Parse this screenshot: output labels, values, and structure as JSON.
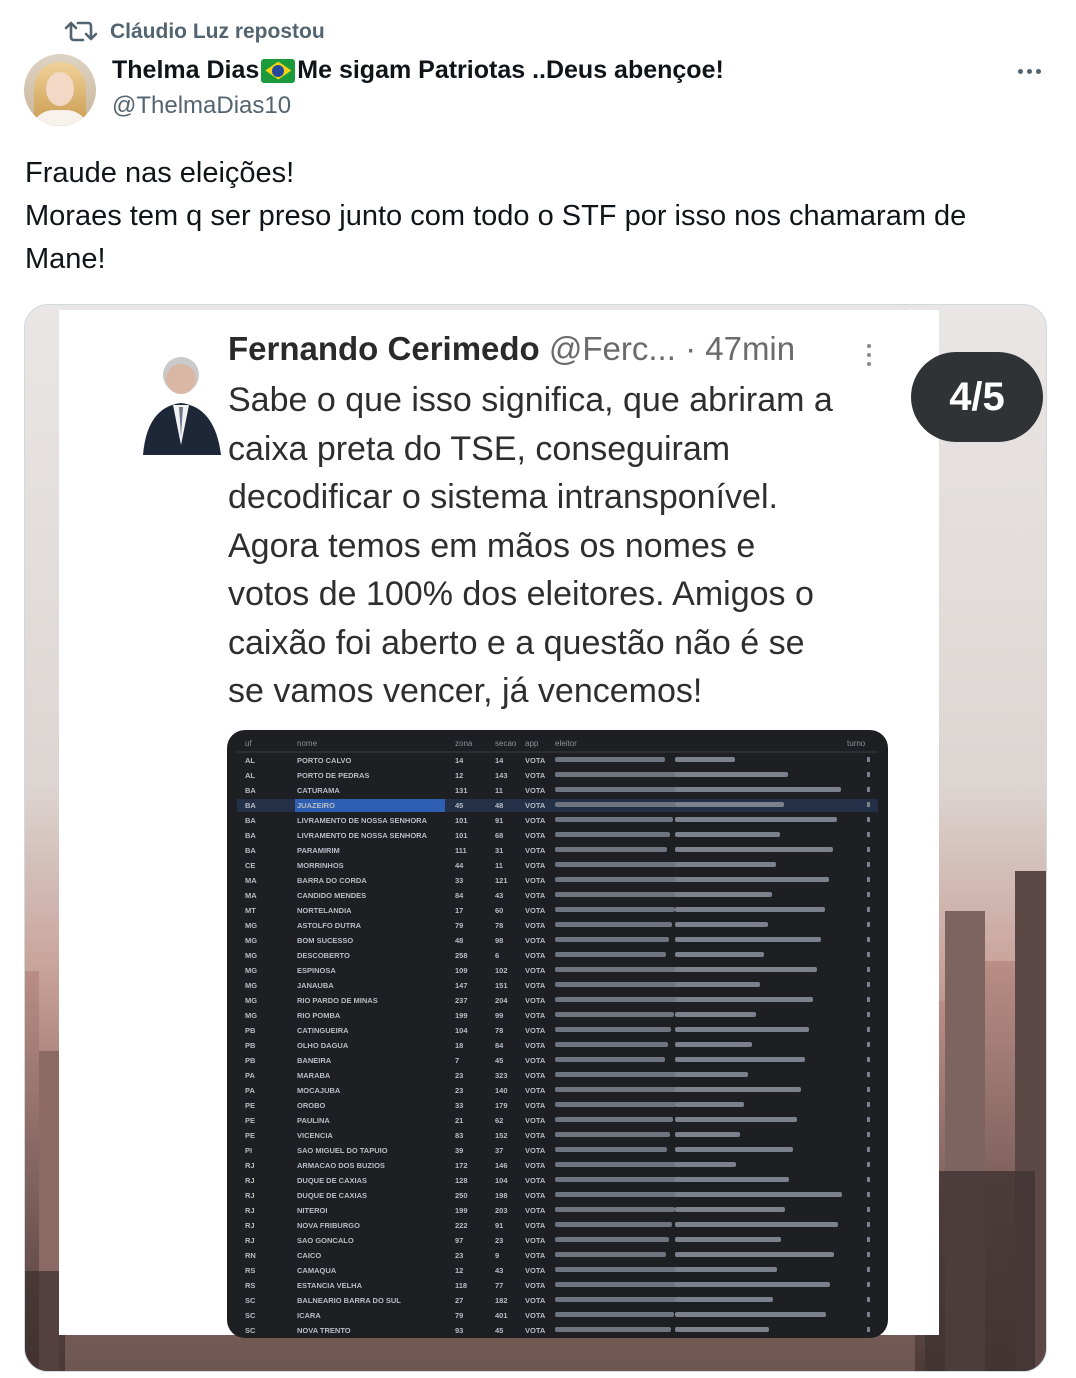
{
  "repost": {
    "icon": "repost-icon",
    "text": "Cláudio Luz repostou"
  },
  "author": {
    "name_part1": "Thelma Dias",
    "flag_icon": "brazil-flag-emoji",
    "name_part2": "Me sigam Patriotas ..Deus abençoe!",
    "handle": "@ThelmaDias10"
  },
  "post": {
    "lines": [
      "Fraude nas eleições!",
      "Moraes tem q ser preso junto com todo o STF por isso nos chamaram de",
      "Mane!"
    ]
  },
  "media": {
    "pager": "4/5",
    "ghost_pager": "4/5",
    "quoted": {
      "name": "Fernando Cerimedo",
      "handle": "@Ferc...",
      "time": "· 47min",
      "lines": [
        "Sabe o que isso significa, que abriram a",
        "caixa preta do TSE, conseguiram",
        "decodificar o sistema intransponível.",
        "Agora temos em mãos os nomes e",
        "votos de 100% dos eleitores. Amigos o",
        "caixão foi aberto e a questão não é se",
        "se vamos vencer, já vencemos!"
      ]
    },
    "table": {
      "headers": [
        "uf",
        "nome",
        "zona",
        "secao",
        "app",
        "eleitor",
        "turno"
      ],
      "rows": [
        [
          "AL",
          "PORTO CALVO",
          "14",
          "14",
          "VOTA"
        ],
        [
          "AL",
          "PORTO DE PEDRAS",
          "12",
          "143",
          "VOTA"
        ],
        [
          "BA",
          "CATURAMA",
          "131",
          "11",
          "VOTA"
        ],
        [
          "BA",
          "JUAZEIRO",
          "45",
          "48",
          "VOTA"
        ],
        [
          "BA",
          "LIVRAMENTO DE NOSSA SENHORA",
          "101",
          "91",
          "VOTA"
        ],
        [
          "BA",
          "LIVRAMENTO DE NOSSA SENHORA",
          "101",
          "68",
          "VOTA"
        ],
        [
          "BA",
          "PARAMIRIM",
          "111",
          "31",
          "VOTA"
        ],
        [
          "CE",
          "MORRINHOS",
          "44",
          "11",
          "VOTA"
        ],
        [
          "MA",
          "BARRA DO CORDA",
          "33",
          "121",
          "VOTA"
        ],
        [
          "MA",
          "CANDIDO MENDES",
          "84",
          "43",
          "VOTA"
        ],
        [
          "MT",
          "NORTELANDIA",
          "17",
          "60",
          "VOTA"
        ],
        [
          "MG",
          "ASTOLFO DUTRA",
          "79",
          "78",
          "VOTA"
        ],
        [
          "MG",
          "BOM SUCESSO",
          "48",
          "98",
          "VOTA"
        ],
        [
          "MG",
          "DESCOBERTO",
          "258",
          "6",
          "VOTA"
        ],
        [
          "MG",
          "ESPINOSA",
          "109",
          "102",
          "VOTA"
        ],
        [
          "MG",
          "JANAUBA",
          "147",
          "151",
          "VOTA"
        ],
        [
          "MG",
          "RIO PARDO DE MINAS",
          "237",
          "204",
          "VOTA"
        ],
        [
          "MG",
          "RIO POMBA",
          "199",
          "99",
          "VOTA"
        ],
        [
          "PB",
          "CATINGUEIRA",
          "104",
          "78",
          "VOTA"
        ],
        [
          "PB",
          "OLHO DAGUA",
          "18",
          "84",
          "VOTA"
        ],
        [
          "PB",
          "BANEIRA",
          "7",
          "45",
          "VOTA"
        ],
        [
          "PA",
          "MARABA",
          "23",
          "323",
          "VOTA"
        ],
        [
          "PA",
          "MOCAJUBA",
          "23",
          "140",
          "VOTA"
        ],
        [
          "PE",
          "OROBO",
          "33",
          "179",
          "VOTA"
        ],
        [
          "PE",
          "PAULINA",
          "21",
          "62",
          "VOTA"
        ],
        [
          "PE",
          "VICENCIA",
          "83",
          "152",
          "VOTA"
        ],
        [
          "PI",
          "SAO MIGUEL DO TAPUIO",
          "39",
          "37",
          "VOTA"
        ],
        [
          "RJ",
          "ARMACAO DOS BUZIOS",
          "172",
          "146",
          "VOTA"
        ],
        [
          "RJ",
          "DUQUE DE CAXIAS",
          "128",
          "104",
          "VOTA"
        ],
        [
          "RJ",
          "DUQUE DE CAXIAS",
          "250",
          "198",
          "VOTA"
        ],
        [
          "RJ",
          "NITEROI",
          "199",
          "203",
          "VOTA"
        ],
        [
          "RJ",
          "NOVA FRIBURGO",
          "222",
          "91",
          "VOTA"
        ],
        [
          "RJ",
          "SAO GONCALO",
          "97",
          "23",
          "VOTA"
        ],
        [
          "RN",
          "CAICO",
          "23",
          "9",
          "VOTA"
        ],
        [
          "RS",
          "CAMAQUA",
          "12",
          "43",
          "VOTA"
        ],
        [
          "RS",
          "ESTANCIA VELHA",
          "118",
          "77",
          "VOTA"
        ],
        [
          "SC",
          "BALNEARIO BARRA DO SUL",
          "27",
          "182",
          "VOTA"
        ],
        [
          "SC",
          "ICARA",
          "79",
          "401",
          "VOTA"
        ],
        [
          "SC",
          "NOVA TRENTO",
          "93",
          "45",
          "VOTA"
        ]
      ]
    }
  },
  "colors": {
    "text": "#0f1419",
    "secondary": "#536471",
    "pager_bg": "#2f3336"
  }
}
